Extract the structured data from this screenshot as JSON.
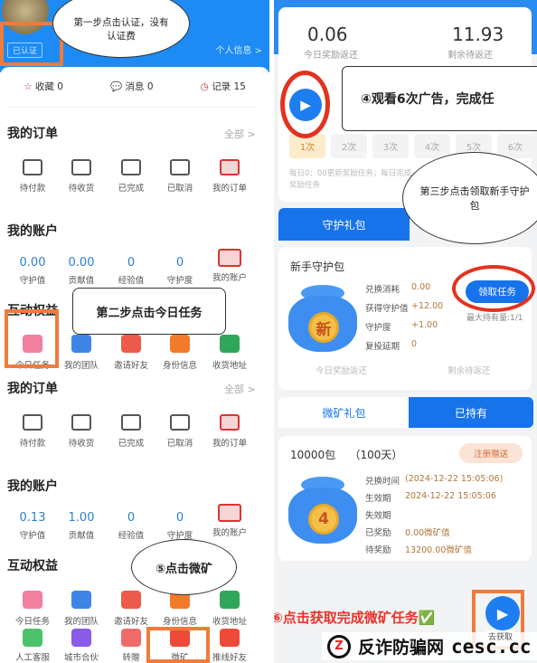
{
  "left": {
    "verified_badge": "已认证",
    "profile_link": "个人信息 >",
    "stats": [
      {
        "label": "收藏",
        "value": "0"
      },
      {
        "label": "消息",
        "value": "0"
      },
      {
        "label": "记录",
        "value": "15"
      }
    ],
    "orders1": {
      "title": "我的订单",
      "more": "全部 >",
      "items": [
        "待付款",
        "待收货",
        "已完成",
        "已取消",
        "我的订单"
      ]
    },
    "account1": {
      "title": "我的账户",
      "values": [
        "0.00",
        "0.00",
        "0",
        "0"
      ],
      "labels": [
        "守护值",
        "贡献值",
        "经验值",
        "守护度",
        "我的账户"
      ]
    },
    "rights1": {
      "title": "互动权益",
      "items": [
        "今日任务",
        "我的团队",
        "邀请好友",
        "身份信息",
        "收货地址"
      ]
    },
    "orders2": {
      "title": "我的订单",
      "more": "全部 >",
      "items": [
        "待付款",
        "待收货",
        "已完成",
        "已取消",
        "我的订单"
      ]
    },
    "account2": {
      "title": "我的账户",
      "values": [
        "0.13",
        "1.00",
        "0",
        "0"
      ],
      "labels": [
        "守护值",
        "贡献值",
        "经验值",
        "守护度",
        "我的账户"
      ]
    },
    "rights2": {
      "title": "互动权益",
      "items": [
        "今日任务",
        "我的团队",
        "邀请好友",
        "身份信息",
        "收货地址"
      ],
      "items2": [
        "人工客服",
        "城市合伙",
        "转赠",
        "微矿",
        "推线好友"
      ]
    }
  },
  "right": {
    "today_reward": "0.06",
    "today_reward_label": "今日奖励返还",
    "remaining": "11.93",
    "remaining_label": "剩余待返还",
    "counts": [
      "1次",
      "2次",
      "3次",
      "4次",
      "5次",
      "6次"
    ],
    "note": "每日0：00更新奖励任务；每日完成…",
    "note2": "奖励任务",
    "guard_gift_btn": "守护礼包",
    "newbie": {
      "title": "新手守护包",
      "coin": "新",
      "rows": [
        {
          "k": "兑换消耗",
          "v": "0.00"
        },
        {
          "k": "获得守护值",
          "v": "+12.00"
        },
        {
          "k": "守护度",
          "v": "+1.00"
        },
        {
          "k": "复投延期",
          "v": "0"
        }
      ],
      "claim_btn": "领取任务",
      "max_hold": "最大持有量:1/1",
      "faded1": "今日奖励返还",
      "faded2": "剩余待返还"
    },
    "tabs": [
      "微矿礼包",
      "已持有"
    ],
    "pack": {
      "title": "10000包",
      "days": "（100天）",
      "tag": "注册赠送",
      "coin": "4",
      "rows": [
        {
          "k": "兑换时间",
          "v": "(2024-12-22 15:05:06)"
        },
        {
          "k": "生效期",
          "v": "2024-12-22 15:05:06"
        },
        {
          "k": "失效期",
          "v": ""
        },
        {
          "k": "已奖励",
          "v": "0.00微矿值"
        },
        {
          "k": "待奖励",
          "v": "13200.00微矿值"
        }
      ]
    },
    "get_label": "去获取"
  },
  "annotations": {
    "step1": "第一步点击认证，没有认证费",
    "step2": "第二步点击今日任务",
    "step3": "第三步点击领取新手守护包",
    "step4": "④观看6次广告，完成任",
    "step5": "⑤点击微矿",
    "step6": "⑥点击获取完成微矿任务✅"
  },
  "watermark": {
    "site": "反诈防骗网",
    "domain": "cesc.cc",
    "logo": "Z"
  },
  "colors": {
    "brand_blue": "#1d8bf3",
    "highlight_orange": "#f07b3a",
    "ring_red": "#e3321f"
  }
}
